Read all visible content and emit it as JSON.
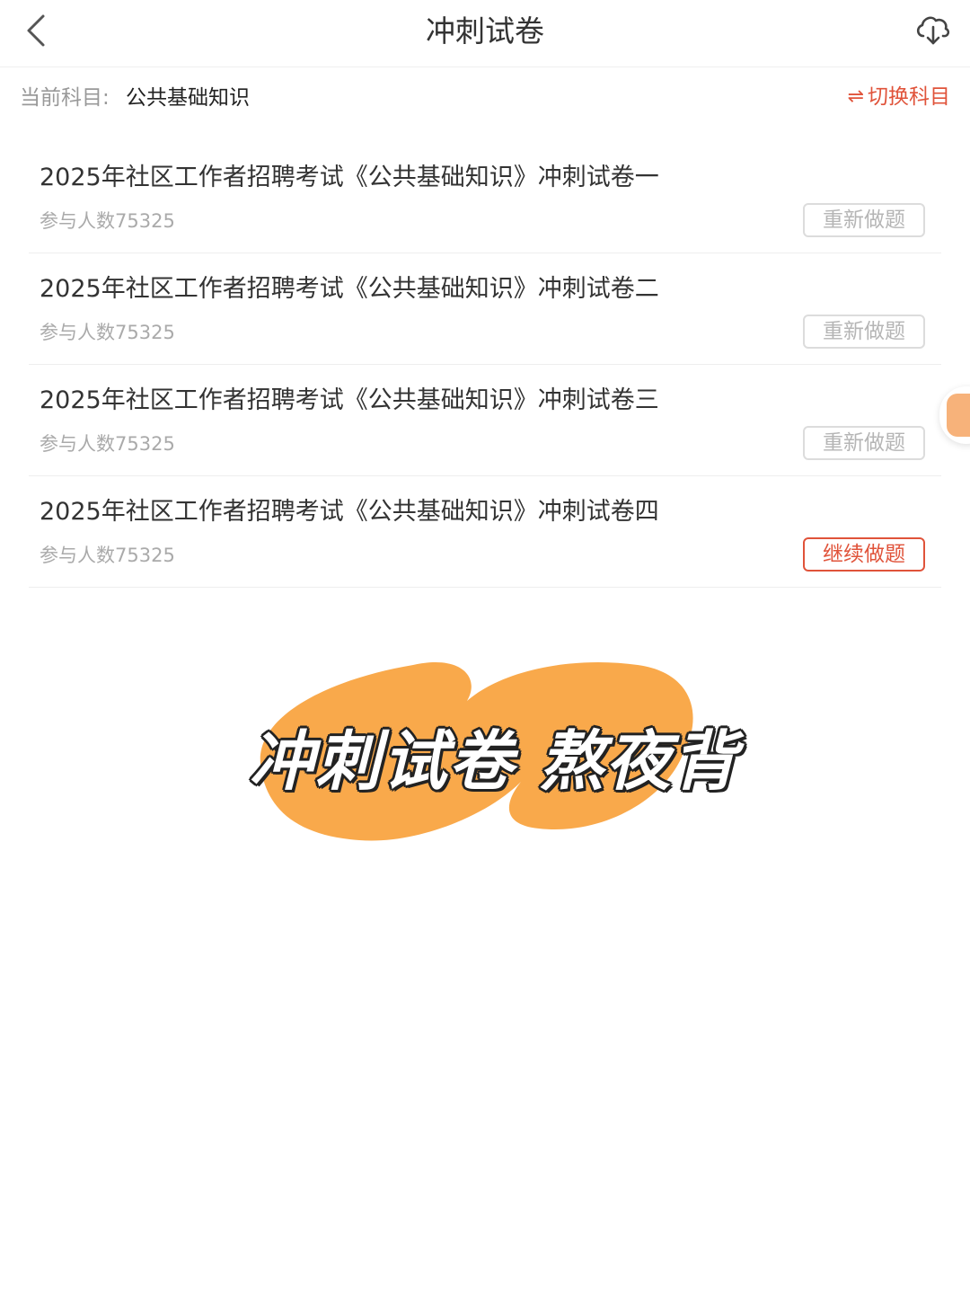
{
  "header": {
    "title": "冲刺试卷",
    "back_icon": "chevron-left-icon",
    "download_icon": "cloud-download-icon"
  },
  "subject": {
    "label": "当前科目:",
    "value": "公共基础知识",
    "switch_icon": "⇌",
    "switch_label": "切换科目"
  },
  "papers": [
    {
      "title": "2025年社区工作者招聘考试《公共基础知识》冲刺试卷一",
      "participants": "参与人数75325",
      "action": "重新做题"
    },
    {
      "title": "2025年社区工作者招聘考试《公共基础知识》冲刺试卷二",
      "participants": "参与人数75325",
      "action": "重新做题"
    },
    {
      "title": "2025年社区工作者招聘考试《公共基础知识》冲刺试卷三",
      "participants": "参与人数75325",
      "action": "重新做题"
    },
    {
      "title": "2025年社区工作者招聘考试《公共基础知识》冲刺试卷四",
      "participants": "参与人数75325",
      "action": "继续做题"
    }
  ],
  "banner": {
    "text": "冲刺试卷 熬夜背",
    "brush_color": "#f9a94b"
  },
  "colors": {
    "accent": "#e0533a",
    "muted_button": "#b5b5b5"
  }
}
